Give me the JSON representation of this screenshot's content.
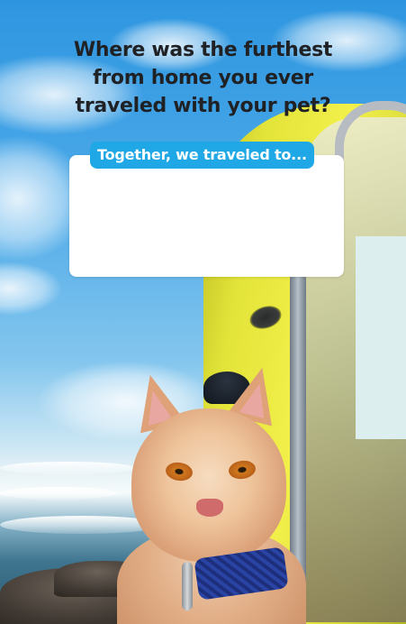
{
  "story": {
    "question": "Where was the furthest from home you ever traveled with your pet?",
    "prompt_label": "Together, we traveled to...",
    "answer_value": "",
    "answer_placeholder": ""
  },
  "background": {
    "photo_subject": "cat-in-backpack-at-beach"
  },
  "colors": {
    "prompt_pill": "#20a8e6",
    "question_text": "#1f2125",
    "answer_card": "#ffffff",
    "side_panel": "#dcefee"
  }
}
